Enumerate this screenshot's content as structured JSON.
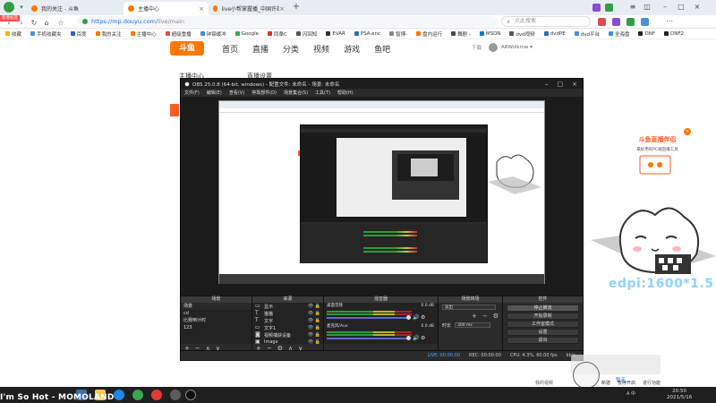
{
  "browser": {
    "tabs": [
      {
        "label": "我的关注 - 斗鱼",
        "active": false,
        "fav_color": "#ff7700"
      },
      {
        "label": "主播中心",
        "active": true,
        "fav_color": "#ff7700"
      },
      {
        "label": "live小帮掌握播_中国许雄宽播_",
        "active": false,
        "fav_color": "#ff7700"
      }
    ],
    "url_host": "https://mp.douyu.com",
    "url_path": "/live/main",
    "search_placeholder": "点此搜索",
    "tab_badge": "新增标签",
    "bookmarks": [
      {
        "label": "收藏",
        "color": "#f5b400"
      },
      {
        "label": "手机收藏夹",
        "color": "#4a90d9"
      },
      {
        "label": "百度",
        "color": "#2e5ed6"
      },
      {
        "label": "我的关注",
        "color": "#ff7700"
      },
      {
        "label": "主播中心",
        "color": "#ff7700"
      },
      {
        "label": "超级重播",
        "color": "#e04b4b"
      },
      {
        "label": "钟锦缓冲",
        "color": "#3a8ee6"
      },
      {
        "label": "Google",
        "color": "#34a853"
      },
      {
        "label": "同桑C",
        "color": "#d93025"
      },
      {
        "label": "闪回知",
        "color": "#555"
      },
      {
        "label": "EVAR",
        "color": "#333"
      },
      {
        "label": "PSA.enc",
        "color": "#2b6cb0"
      },
      {
        "label": "智博-",
        "color": "#888"
      },
      {
        "label": "盘内运行",
        "color": "#ff7700"
      },
      {
        "label": "舞剧 -",
        "color": "#4a4a4a"
      },
      {
        "label": "MSDN",
        "color": "#0078d4"
      },
      {
        "label": "dvd视频",
        "color": "#555"
      },
      {
        "label": "dvdPE",
        "color": "#2b6cb0"
      },
      {
        "label": "dvd平台",
        "color": "#4a90d9"
      },
      {
        "label": "全海盘",
        "color": "#3a8ee6"
      },
      {
        "label": "DNF",
        "color": "#222"
      },
      {
        "label": "DNF2",
        "color": "#222"
      }
    ],
    "extension_colors": [
      "#e04b4b",
      "#8a4bd6",
      "#2ea043",
      "#4a90d9"
    ]
  },
  "douyu": {
    "logo_text": "斗鱼",
    "menu": [
      "首页",
      "直播",
      "分类",
      "视频",
      "游戏",
      "鱼吧"
    ],
    "right_link": "下载",
    "username": "ARWolkmw ▾",
    "sidebar_label": "主播中心",
    "section_label": "直播设置",
    "promo_title": "斗鱼直播伴侣",
    "promo_desc": "最好用的PC端直播工具",
    "edpi_text": "edpi:1600*1.5"
  },
  "obs": {
    "title": "OBS 25.0.8 (64-bit, windows) - 配置文件: 未命名 - 场景: 未命名",
    "menu": [
      "文件(F)",
      "编辑(E)",
      "查看(V)",
      "停靠部件(D)",
      "场景集合(S)",
      "工具(T)",
      "帮助(H)"
    ],
    "docks": {
      "scenes": {
        "title": "场景",
        "items": [
          "场景",
          "cd",
          "比赛倒计时",
          "123"
        ]
      },
      "sources": {
        "title": "来源",
        "items": [
          {
            "label": "显示",
            "icon": "monitor-icon"
          },
          {
            "label": "猫猫",
            "icon": "text-icon"
          },
          {
            "label": "文字",
            "icon": "text-icon"
          },
          {
            "label": "文字1",
            "icon": "monitor-icon"
          },
          {
            "label": "视频捕获设备",
            "icon": "camera-icon"
          },
          {
            "label": "Image",
            "icon": "image-icon"
          }
        ]
      },
      "mixer": {
        "title": "混音器",
        "rows": [
          {
            "label": "桌面音频",
            "db": "0.0 dB"
          },
          {
            "label": "麦克风/Aux",
            "db": "0.0 dB"
          }
        ]
      },
      "transitions": {
        "title": "场景转场",
        "type_label": "淡出",
        "duration_label": "时长",
        "duration_value": "300 ms"
      },
      "controls": {
        "title": "控件",
        "buttons": [
          "停止推流",
          "开始录制",
          "工作室模式",
          "设置",
          "退出"
        ]
      }
    },
    "status": {
      "live": "LIVE: 00:00:00",
      "rec": "REC: 00:00:00",
      "cpu": "CPU: 4.3%, 60.00 fps",
      "bitrate": "kb/s"
    }
  },
  "taskbar": {
    "ticker": "I'm So Hot - MOMOLAND",
    "clock_time": "20:50",
    "clock_date": "2021/5/16",
    "tray_text": "A 中"
  },
  "overlay": {
    "notify": "暂无",
    "dl_label": "我的视频",
    "rec_labels": [
      "新建",
      "暂停开启",
      "进行功能"
    ]
  }
}
